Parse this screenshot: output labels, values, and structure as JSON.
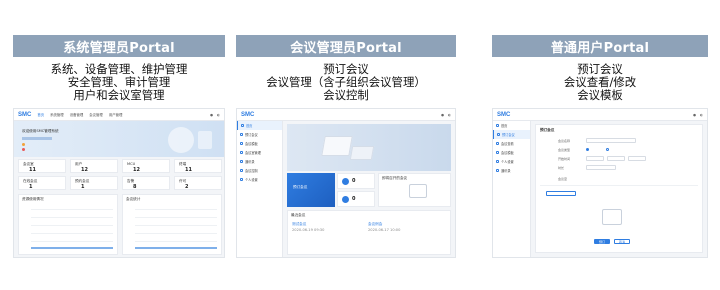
{
  "columns": [
    {
      "title": "系统管理员Portal",
      "lines": [
        "系统、设备管理、维护管理",
        "安全管理、审计管理",
        "用户和会议室管理"
      ]
    },
    {
      "title": "会议管理员Portal",
      "lines": [
        "预订会议",
        "会议管理（含子组织会议管理）",
        "会议控制"
      ]
    },
    {
      "title": "普通用户Portal",
      "lines": [
        "预订会议",
        "会议查看/修改",
        "会议模板"
      ]
    }
  ],
  "screens": {
    "logo": "SMC",
    "admin": {
      "tabs": [
        "首页",
        "系统管理",
        "设备管理",
        "会议管理",
        "用户管理",
        "安全管理",
        "审计管理"
      ],
      "active_tab": "首页",
      "banner_text": "欢迎使用SMC管理系统",
      "stats": [
        {
          "label": "会议室",
          "value": "11"
        },
        {
          "label": "用户",
          "value": "12"
        },
        {
          "label": "MCU",
          "value": "12"
        },
        {
          "label": "终端",
          "value": "11"
        },
        {
          "label": "在线会议",
          "value": "1"
        },
        {
          "label": "预约会议",
          "value": "1"
        },
        {
          "label": "告警",
          "value": "8"
        },
        {
          "label": "许可",
          "value": "2"
        }
      ],
      "chart_titles": [
        "资源使用情况",
        "会议统计"
      ],
      "y_ticks": [
        "100",
        "80",
        "60",
        "40",
        "20",
        "0"
      ]
    },
    "conf": {
      "menu": [
        "首页",
        "预订会议",
        "会议模板",
        "会议室管理",
        "通讯录",
        "会议控制",
        "个人设置"
      ],
      "active_menu": "首页",
      "hero_label": "预订会议",
      "counts": [
        {
          "value": "0"
        },
        {
          "value": "0"
        }
      ],
      "upcoming_title": "即将召开的会议",
      "recent_title": "最近会议",
      "meetings": [
        {
          "name": "测试会议",
          "time": "2020-06-19 09:30"
        },
        {
          "name": "会议例会",
          "time": "2020-06-17 10:00"
        }
      ]
    },
    "user": {
      "menu": [
        "首页",
        "预订会议",
        "会议查看",
        "会议模板",
        "个人设置",
        "通讯录"
      ],
      "active_menu": "预订会议",
      "form_title": "预订会议",
      "labels": [
        "会议名称",
        "会议类型",
        "开始时间",
        "时长",
        "会议室"
      ],
      "submit_label": "预订",
      "cancel_label": "取消"
    }
  }
}
